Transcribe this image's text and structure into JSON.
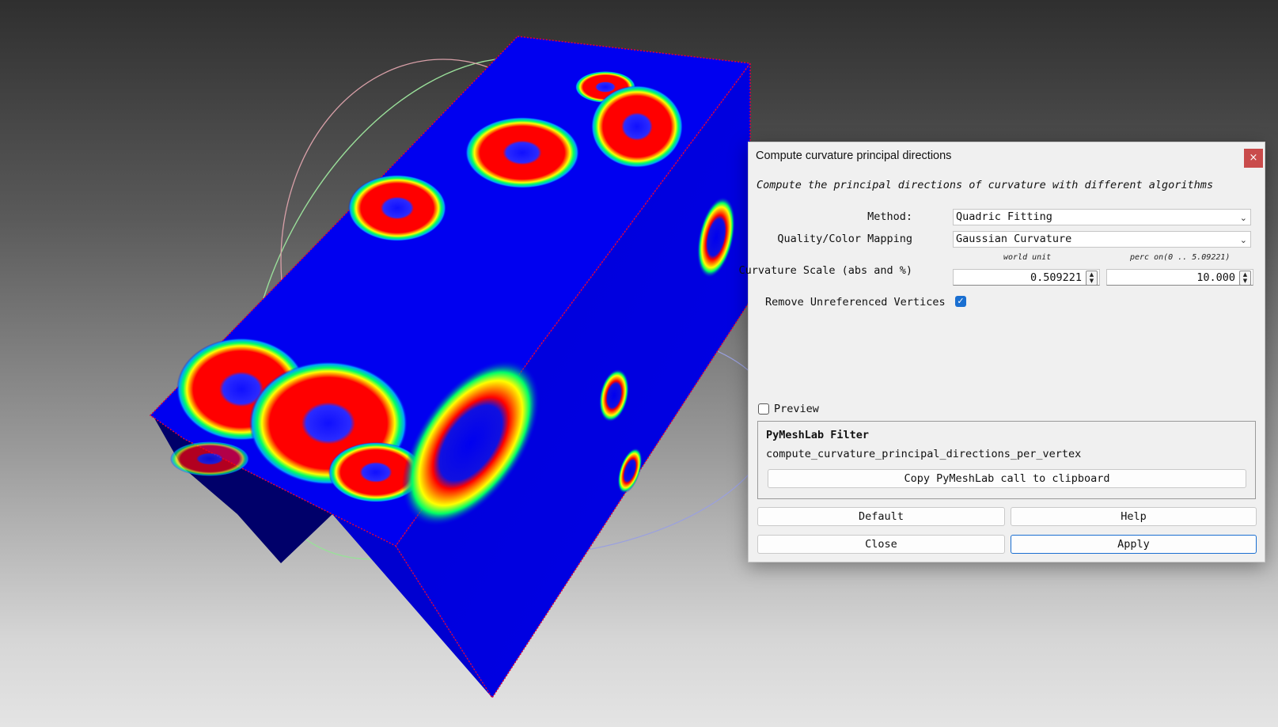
{
  "dialog": {
    "title": "Compute curvature principal directions",
    "close_glyph": "×",
    "description": "Compute the principal directions of curvature with different algorithms",
    "method": {
      "label": "Method:",
      "value": "Quadric Fitting"
    },
    "mapping": {
      "label": "Quality/Color Mapping",
      "value": "Gaussian Curvature"
    },
    "scale": {
      "label": "Curvature Scale (abs and %)",
      "unit_world": "world unit",
      "unit_percent": "perc on(0 .. 5.09221)",
      "world_value": "0.509221",
      "percent_value": "10.000"
    },
    "remove_unref": {
      "label": "Remove Unreferenced Vertices",
      "checked": true
    },
    "preview": {
      "label": "Preview",
      "checked": false
    },
    "pymeshlab": {
      "title": "PyMeshLab Filter",
      "function": "compute_curvature_principal_directions_per_vertex",
      "copy_button": "Copy PyMeshLab call to clipboard"
    },
    "buttons": {
      "default": "Default",
      "help": "Help",
      "close": "Close",
      "apply": "Apply"
    }
  },
  "colors": {
    "mesh_blue": "#0000f0",
    "mesh_dark": "#00005a",
    "hot_red": "#ff0000",
    "accent": "#1a6fd1",
    "close_red": "#c94b4b"
  },
  "icons": {
    "close": "close-icon",
    "dropdown": "chevron-down-icon",
    "spin": "spin-arrows-icon",
    "check": "checkmark-icon"
  }
}
